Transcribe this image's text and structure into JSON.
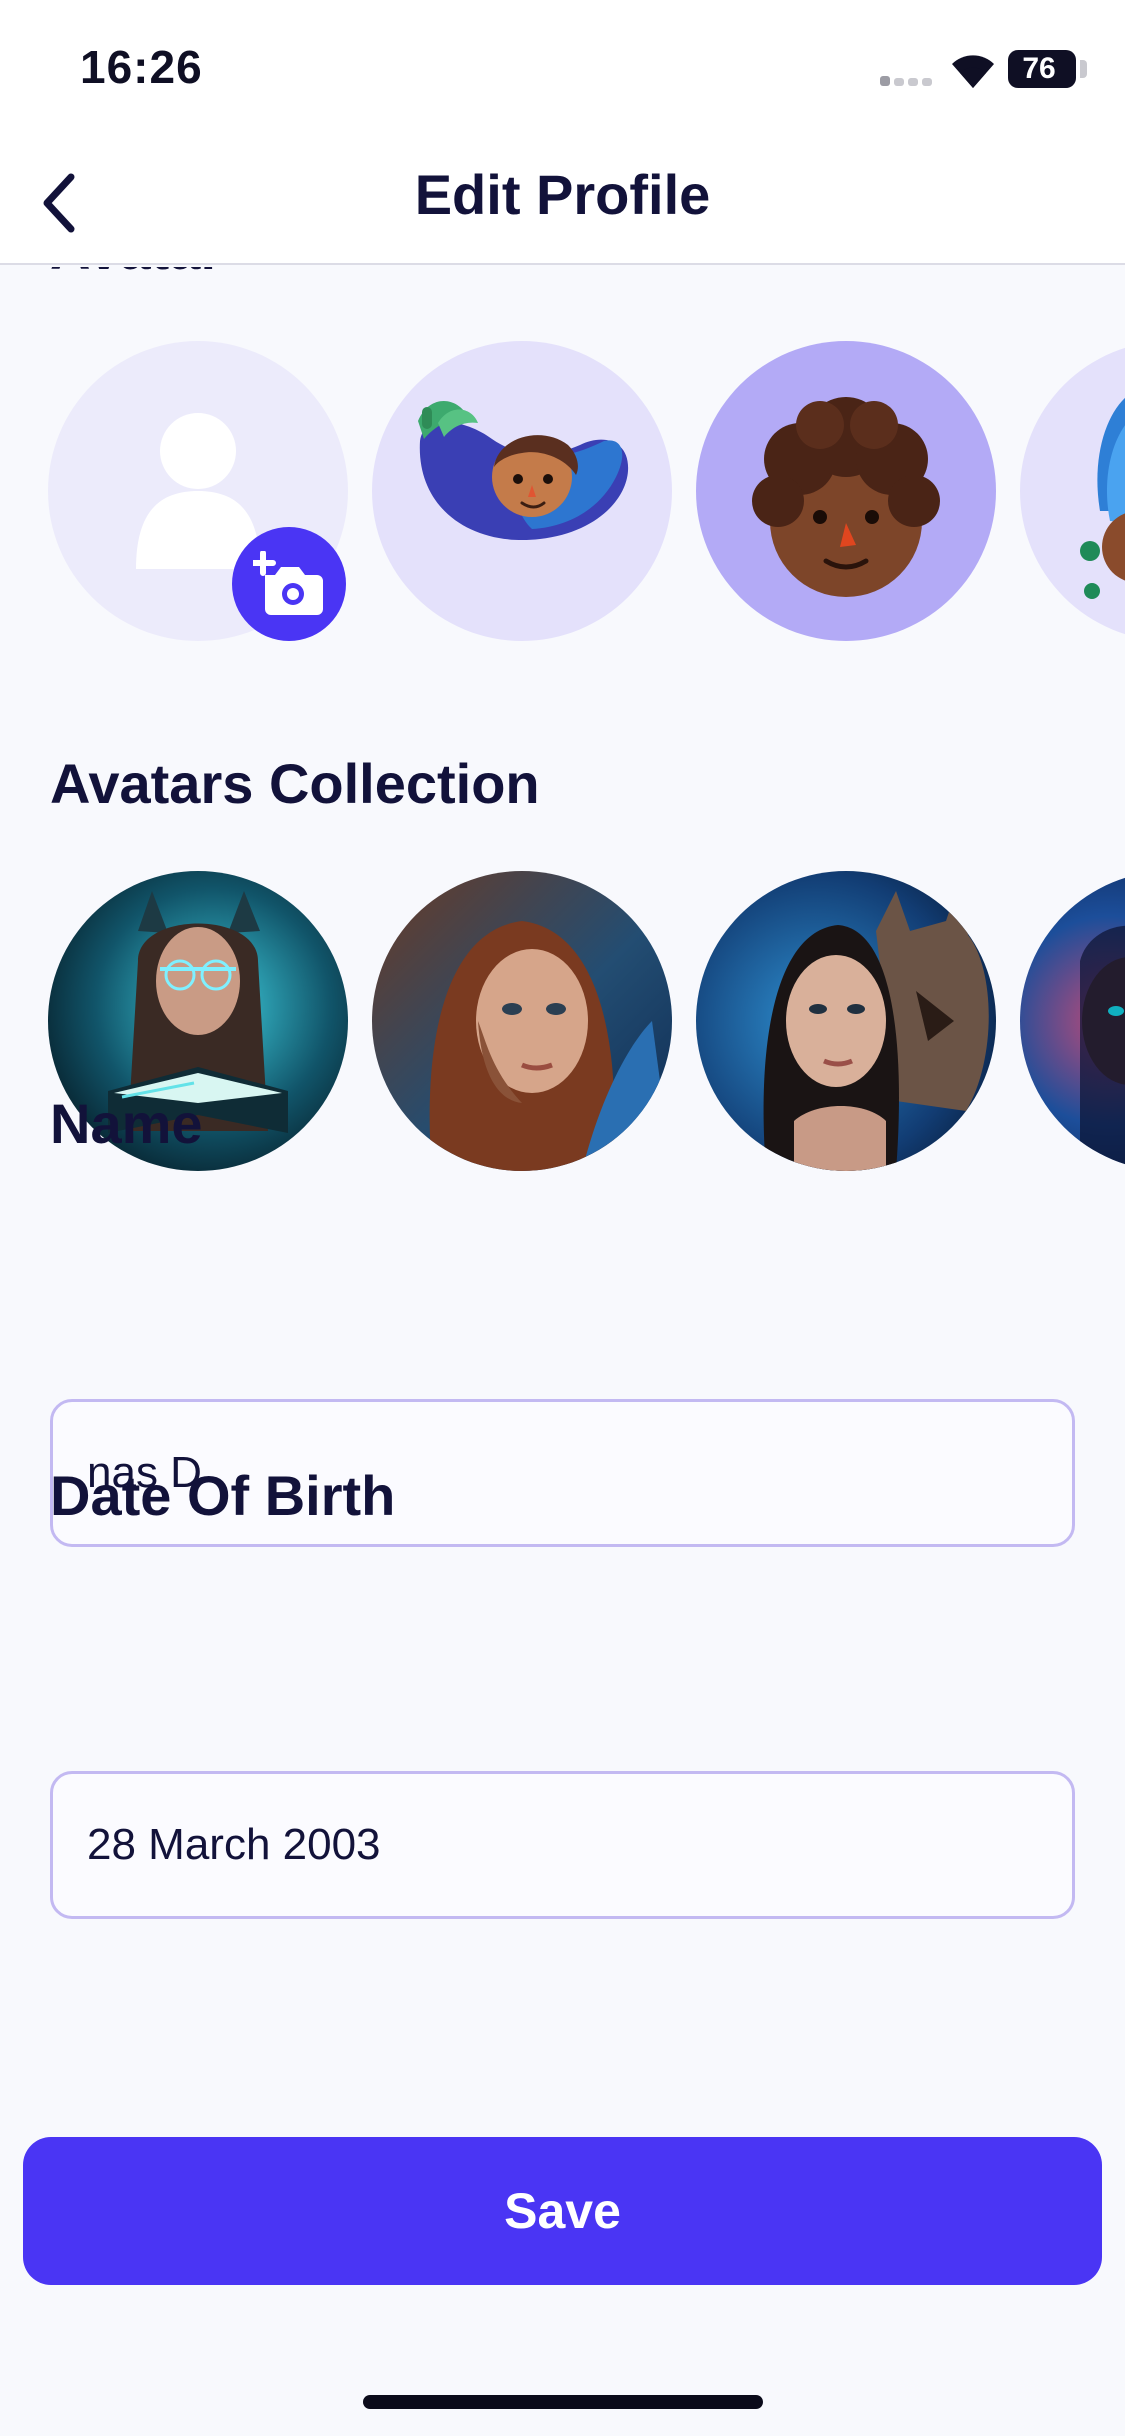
{
  "status_bar": {
    "time": "16:26",
    "battery": "76"
  },
  "header": {
    "title": "Edit Profile"
  },
  "avatar_section": {
    "label": "Avatar",
    "items": [
      "upload-photo",
      "eggplant-avatar",
      "curly-hair-avatar",
      "blue-hat-avatar"
    ]
  },
  "collection_section": {
    "label": "Avatars Collection",
    "items": [
      "girl-reading-book-portrait",
      "woman-red-hair-portrait",
      "woman-with-wolf-portrait",
      "woman-blue-light-portrait"
    ]
  },
  "name_field": {
    "label": "Name",
    "value": "nas D"
  },
  "dob_field": {
    "label": "Date Of Birth",
    "value": "28 March 2003"
  },
  "save_button": {
    "label": "Save"
  },
  "colors": {
    "accent": "#4a35f4",
    "field_border": "#c3b9f2",
    "background": "#f8f9fd",
    "text": "#12123a"
  }
}
